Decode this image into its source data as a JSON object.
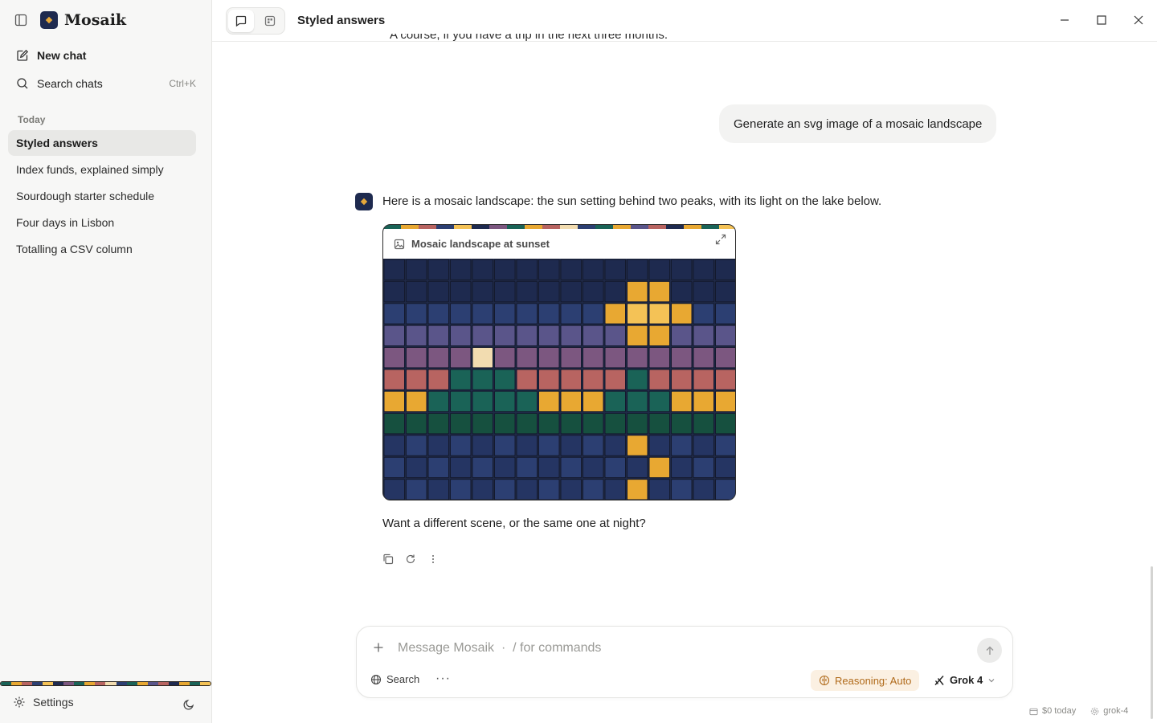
{
  "app": {
    "name": "Mosaik"
  },
  "sidebar": {
    "new_chat": "New chat",
    "search_chats": "Search chats",
    "search_shortcut": "Ctrl+K",
    "section_today": "Today",
    "chats": [
      {
        "title": "Styled answers",
        "active": true
      },
      {
        "title": "Index funds, explained simply",
        "active": false
      },
      {
        "title": "Sourdough starter schedule",
        "active": false
      },
      {
        "title": "Four days in Lisbon",
        "active": false
      },
      {
        "title": "Totalling a CSV column",
        "active": false
      }
    ],
    "settings": "Settings"
  },
  "header": {
    "title": "Styled answers"
  },
  "conversation": {
    "cut_text": "A course, if you have a trip in the next three months.",
    "user_message": "Generate an svg image of a mosaic landscape",
    "assistant_intro": "Here is a mosaic landscape: the sun setting behind two peaks, with its light on the lake below.",
    "artifact_title": "Mosaic landscape at sunset",
    "assistant_followup": "Want a different scene, or the same one at night?"
  },
  "composer": {
    "placeholder": "Message Mosaik  ·  / for commands",
    "search_label": "Search",
    "reasoning_label": "Reasoning: Auto",
    "model_label": "Grok 4"
  },
  "footer": {
    "cost": "$0 today",
    "model": "grok-4"
  },
  "colors": {
    "accent_orange": "#e7a93a",
    "navy": "#1e2a4f",
    "reasoning_bg": "#fbf0e2",
    "reasoning_text": "#b06a1a"
  },
  "mosaic": {
    "palette": {
      "N": "#1e2a4f",
      "B": "#2c3f72",
      "P": "#5a558a",
      "M": "#7c5780",
      "R": "#b86461",
      "T": "#1a6357",
      "D": "#16503f",
      "Y": "#e8a832",
      "L": "#f4c256",
      "C": "#f2dcb0",
      "K": "#253563"
    },
    "rows": [
      "NNNNNNNNNNNNNNNN",
      "NNNNNNNNNNNYYNNN",
      "BBBBBBBBBBYLLYBB",
      "PPPPPPPPPPPYYPPP",
      "MMMMCMMMMMMMMMMM",
      "RRRTTTRRRRRTRRRR",
      "YYTTTTTYYYTTTYYY",
      "DDDDDDDDDDDDDDDD",
      "KBKBKBKBKBKYKBKB",
      "BKBKBKBKBKBKYKBK",
      "KBKBKBKBKBKYKBKB"
    ]
  }
}
